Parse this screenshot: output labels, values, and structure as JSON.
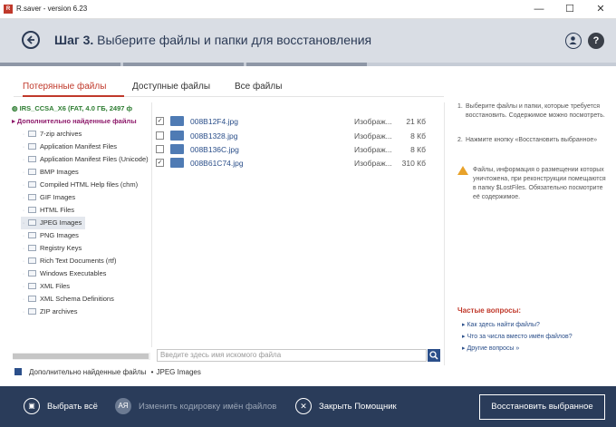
{
  "window": {
    "title": "R.saver - version 6.23",
    "logo": "R",
    "minimize": "—",
    "maximize": "☐",
    "close": "✕"
  },
  "header": {
    "step": "Шаг 3.",
    "title": "Выберите файлы и папки для восстановления",
    "help": "?"
  },
  "tabs": [
    {
      "label": "Потерянные файлы",
      "active": true
    },
    {
      "label": "Доступные файлы",
      "active": false
    },
    {
      "label": "Все файлы",
      "active": false
    }
  ],
  "tree": {
    "root": "IRS_CCSA_X6 (FAT, 4.0 ГБ, 2497 ф",
    "group": "Дополнительно найденные файлы",
    "items": [
      "7-zip archives",
      "Application Manifest Files",
      "Application Manifest Files (Unicode)",
      "BMP Images",
      "Compiled HTML Help files (chm)",
      "GIF Images",
      "HTML Files",
      "JPEG Images",
      "PNG Images",
      "Registry Keys",
      "Rich Text Documents (rtf)",
      "Windows Executables",
      "XML Files",
      "XML Schema Definitions",
      "ZIP archives"
    ],
    "selected": "JPEG Images"
  },
  "files": [
    {
      "name": "008B12F4.jpg",
      "type": "Изображ...",
      "size": "21 Кб",
      "checked": true
    },
    {
      "name": "008B1328.jpg",
      "type": "Изображ...",
      "size": "8 Кб",
      "checked": false
    },
    {
      "name": "008B136C.jpg",
      "type": "Изображ...",
      "size": "8 Кб",
      "checked": false
    },
    {
      "name": "008B61C74.jpg",
      "type": "Изображ...",
      "size": "310 Кб",
      "checked": true
    }
  ],
  "search": {
    "placeholder": "Введите здесь имя искомого файла"
  },
  "breadcrumb": {
    "parent": "Дополнительно найденные файлы",
    "separator": "•",
    "current": "JPEG Images"
  },
  "instructions": [
    {
      "num": "1.",
      "text": "Выберите файлы и папки, которые требуется восстановить. Содержимое можно посмотреть."
    },
    {
      "num": "2.",
      "text": "Нажмите кнопку «Восстановить выбранное»"
    }
  ],
  "warning": "Файлы, информация о размещении которых уничтожена, при реконструкции помещаются в папку $LostFiles. Обязательно посмотрите её содержимое.",
  "faq": {
    "title": "Частые вопросы:",
    "items": [
      "Как здесь найти файлы?",
      "Что за числа вместо имён файлов?",
      "Другие вопросы »"
    ]
  },
  "footer": {
    "select_all": "Выбрать всё",
    "change_encoding": "Изменить кодировку имён файлов",
    "close_wizard": "Закрыть Помощник",
    "restore": "Восстановить выбранное",
    "encoding_icon": "АЯ"
  },
  "colors": {
    "accent": "#c0392b",
    "footer_bg": "#2a3c5a",
    "header_bg": "#d9dde4",
    "link": "#2b4f8a"
  }
}
